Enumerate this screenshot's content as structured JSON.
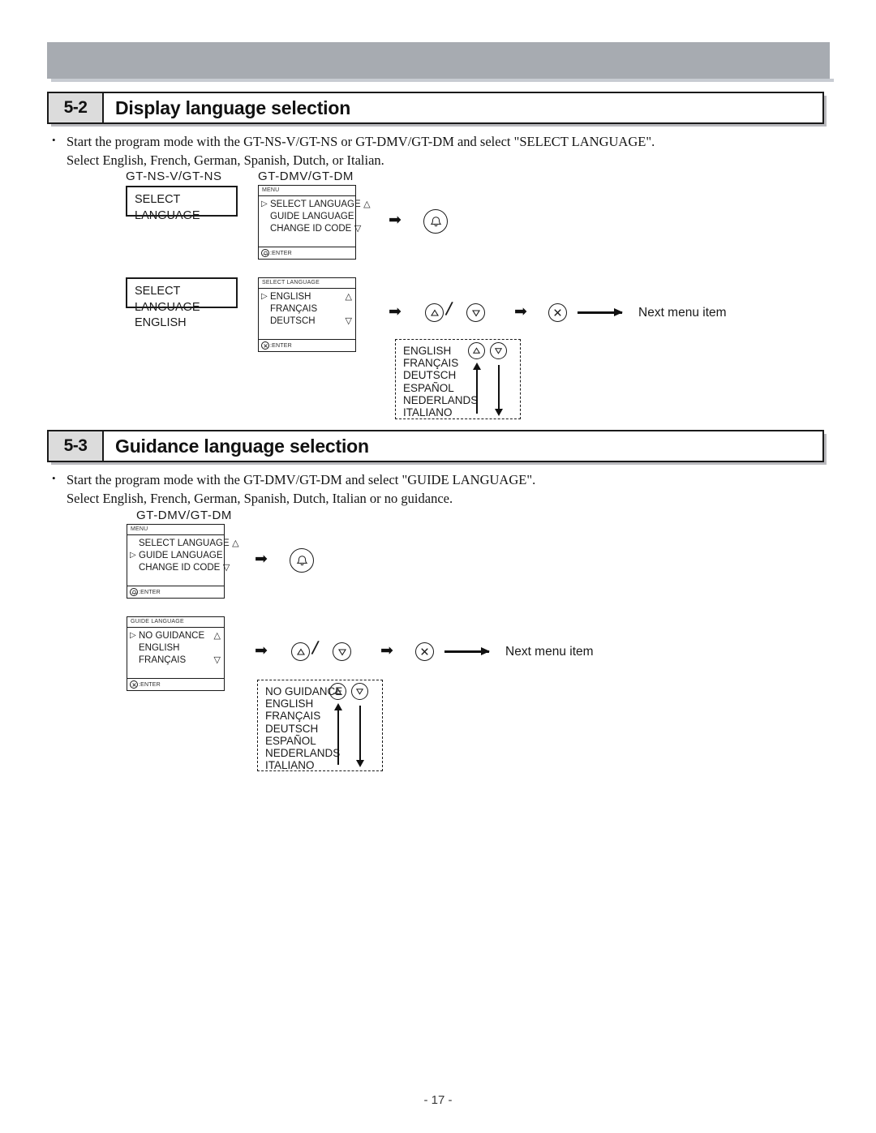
{
  "page": {
    "footer_label": "- 17 -"
  },
  "sections": [
    {
      "number": "5-2",
      "title": "Display language selection",
      "bullet": "•",
      "line1": "Start the program mode with the GT-NS-V/GT-NS or GT-DMV/GT-DM and select \"SELECT LANGUAGE\".",
      "line2": "Select English, French, German, Spanish, Dutch, or Italian."
    },
    {
      "number": "5-3",
      "title": "Guidance language selection",
      "bullet": "•",
      "line1": "Start the program mode with the GT-DMV/GT-DM and select \"GUIDE LANGUAGE\".",
      "line2": "Select English, French, German, Spanish, Dutch, Italian or no guidance."
    }
  ],
  "labels": {
    "dev_ns": "GT-NS-V/GT-NS",
    "dev_dm": "GT-DMV/GT-DM",
    "dev_dm_2": "GT-DMV/GT-DM",
    "next_menu_item_1": "Next menu item",
    "next_menu_item_2": "Next menu item",
    "enter_call": ":ENTER",
    "enter_x": ":ENTER",
    "enter_call_2": ":ENTER",
    "enter_x_2": ":ENTER",
    "arrow_1": "➡",
    "arrow_2": "➡",
    "arrow_3": "➡",
    "arrow_4": "➡",
    "arrow_5": "➡",
    "arrow_6": "➡",
    "slash": "/",
    "slash_2": "/"
  },
  "lcd_simple_1": {
    "line1": "SELECT LANGUAGE",
    "line2": ""
  },
  "lcd_simple_2": {
    "line1": "SELECT LANGUAGE",
    "line2": "ENGLISH"
  },
  "lcd_menu_1": {
    "title": "MENU",
    "rows": [
      {
        "cursor": "▷",
        "text": "SELECT LANGUAGE",
        "scroll": "△"
      },
      {
        "cursor": "",
        "text": "GUIDE LANGUAGE",
        "scroll": ""
      },
      {
        "cursor": "",
        "text": "CHANGE ID CODE",
        "scroll": "▽"
      }
    ],
    "foot_icon": "call-button-icon",
    "foot_label": ":ENTER"
  },
  "lcd_menu_2": {
    "title": "SELECT LANGUAGE",
    "rows": [
      {
        "cursor": "▷",
        "text": "ENGLISH",
        "scroll": "△"
      },
      {
        "cursor": "",
        "text": "FRANÇAIS",
        "scroll": ""
      },
      {
        "cursor": "",
        "text": "DEUTSCH",
        "scroll": "▽"
      }
    ],
    "foot_icon": "x-button-icon",
    "foot_label": ":ENTER"
  },
  "lcd_menu_3": {
    "title": "MENU",
    "rows": [
      {
        "cursor": "",
        "text": "SELECT LANGUAGE",
        "scroll": "△"
      },
      {
        "cursor": "▷",
        "text": "GUIDE LANGUAGE",
        "scroll": ""
      },
      {
        "cursor": "",
        "text": "CHANGE ID CODE",
        "scroll": "▽"
      }
    ],
    "foot_icon": "call-button-icon",
    "foot_label": ":ENTER"
  },
  "lcd_menu_4": {
    "title": "GUIDE LANGUAGE",
    "rows": [
      {
        "cursor": "▷",
        "text": "NO GUIDANCE",
        "scroll": "△"
      },
      {
        "cursor": "",
        "text": "ENGLISH",
        "scroll": ""
      },
      {
        "cursor": "",
        "text": "FRANÇAIS",
        "scroll": "▽"
      }
    ],
    "foot_icon": "x-button-icon",
    "foot_label": ":ENTER"
  },
  "lang_list_display": {
    "items": [
      "ENGLISH",
      "FRANÇAIS",
      "DEUTSCH",
      "ESPAÑOL",
      "NEDERLANDS",
      "ITALIANO"
    ]
  },
  "lang_list_guidance": {
    "items": [
      "NO GUIDANCE",
      "ENGLISH",
      "FRANÇAIS",
      "DEUTSCH",
      "ESPAÑOL",
      "NEDERLANDS",
      "ITALIANO"
    ]
  },
  "icons": {
    "up_triangle": "△",
    "down_triangle": "▽",
    "call_bell": "call-bell-icon",
    "x_mark": "x-mark-icon"
  },
  "colors": {
    "top_bar": "#a7abb1",
    "section_num_bg": "#dcdcdc",
    "ink": "#1a1a1a"
  }
}
